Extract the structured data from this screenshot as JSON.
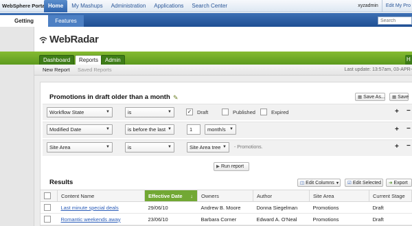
{
  "portal": {
    "brand": "WebSphere Portal",
    "nav": [
      "Home",
      "My Mashups",
      "Administration",
      "Applications",
      "Search Center"
    ],
    "user": "xyzadmin",
    "edit_profile": "Edit My Pro"
  },
  "subbar": {
    "tabs": [
      "Getting Started",
      "Features"
    ],
    "search_placeholder": "Search"
  },
  "app": {
    "logo_text": "WebRadar",
    "tabs": [
      "Dashboard",
      "Reports",
      "Admin"
    ],
    "help_tab": "H"
  },
  "subnav": {
    "new_report": "New Report",
    "saved_reports": "Saved Reports",
    "last_update": "Last update: 13:57am, 03-APR-"
  },
  "report": {
    "title": "Promotions in draft older than a month",
    "save_as": "Save As...",
    "save": "Save",
    "filters": [
      {
        "field": "Workflow State",
        "operator": "is",
        "options": [
          "Draft",
          "Published",
          "Expired"
        ],
        "checked": [
          true,
          false,
          false
        ]
      },
      {
        "field": "Modified Date",
        "operator": "is before the last",
        "amount": "1",
        "unit": "month/s"
      },
      {
        "field": "Site Area",
        "operator": "is",
        "value": "Site Area tree",
        "hint": "- Promotions."
      }
    ],
    "run_label": "Run report"
  },
  "results": {
    "title": "Results",
    "edit_columns": "Edit Columns",
    "edit_selected": "Edit Selected",
    "export": "Export",
    "columns": [
      "Content Name",
      "Effective Date",
      "Owners",
      "Author",
      "Site Area",
      "Current Stage"
    ],
    "sort_indicator": "↓",
    "rows": [
      {
        "name": "Last minute special deals",
        "date": "29/06/10",
        "owners": "Andrew B. Moore",
        "author": "Donna Siegelman",
        "site_area": "Promotions",
        "stage": "Draft"
      },
      {
        "name": "Romantic weekends away",
        "date": "23/06/10",
        "owners": "Barbara Corner",
        "author": "Edward A. O'Neal",
        "site_area": "Promotions",
        "stage": "Draft"
      }
    ]
  },
  "colors": {
    "portal_active": "#2f64ad",
    "green_bar": "#5c9a1e",
    "sorted_header": "#72a834",
    "link": "#2a5cb8"
  }
}
